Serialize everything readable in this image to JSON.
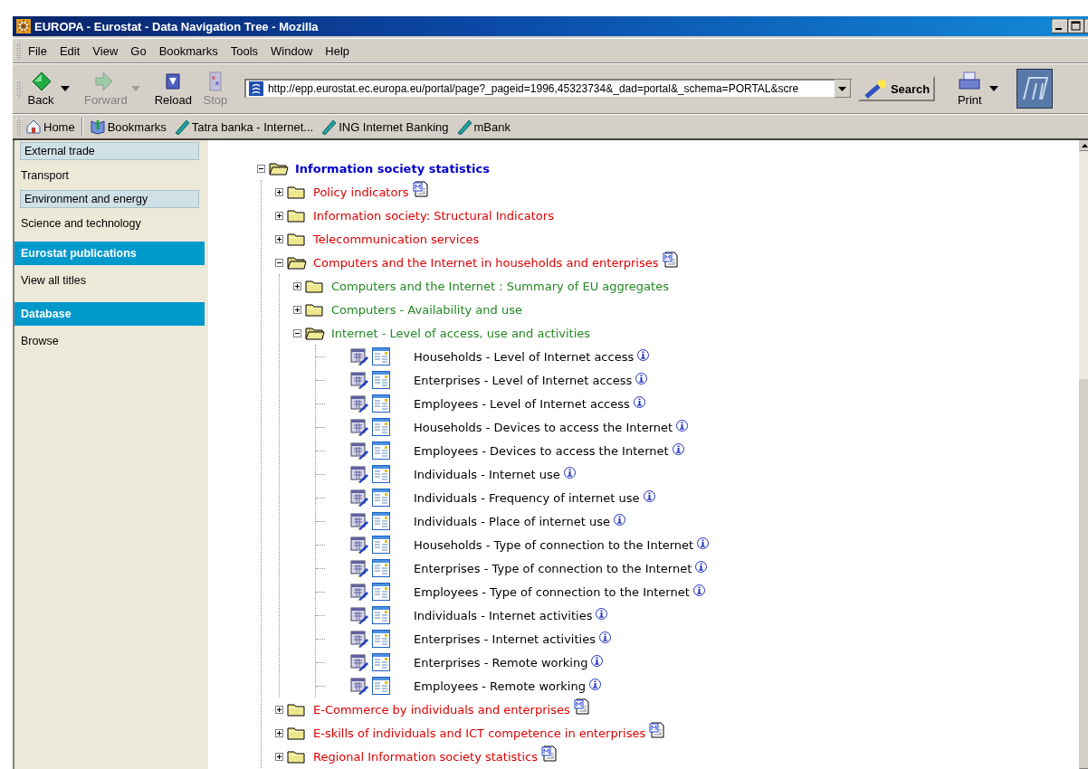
{
  "window": {
    "title": "EUROPA - Eurostat - Data Navigation Tree - Mozilla"
  },
  "menu": [
    "File",
    "Edit",
    "View",
    "Go",
    "Bookmarks",
    "Tools",
    "Window",
    "Help"
  ],
  "toolbar": {
    "buttons": [
      {
        "label": "Back",
        "kind": "back",
        "disabled": false,
        "dropdown": true
      },
      {
        "label": "Forward",
        "kind": "forward",
        "disabled": true,
        "dropdown": true
      },
      {
        "label": "Reload",
        "kind": "reload",
        "disabled": false,
        "dropdown": false
      },
      {
        "label": "Stop",
        "kind": "stop",
        "disabled": true,
        "dropdown": false
      }
    ],
    "address": "http://epp.eurostat.ec.europa.eu/portal/page?_pageid=1996,45323734&_dad=portal&_schema=PORTAL&scre",
    "search_button": "Search",
    "print_button": "Print"
  },
  "bookmarks": [
    {
      "label": "Home",
      "kind": "home"
    },
    {
      "label": "Bookmarks",
      "kind": "bookmarks"
    },
    {
      "label": "Tatra banka - Internet...",
      "kind": "link"
    },
    {
      "label": "ING Internet Banking",
      "kind": "link"
    },
    {
      "label": "mBank",
      "kind": "link"
    }
  ],
  "sidebar": {
    "items": [
      {
        "label": "External trade",
        "kind": "boxed"
      },
      {
        "label": "Transport",
        "kind": "link"
      },
      {
        "label": "Environment and energy",
        "kind": "boxed"
      },
      {
        "label": "Science and technology",
        "kind": "link"
      },
      {
        "label": "Eurostat publications",
        "kind": "header"
      },
      {
        "label": "View all titles",
        "kind": "link"
      },
      {
        "label": "Database",
        "kind": "header"
      },
      {
        "label": "Browse",
        "kind": "link"
      }
    ]
  },
  "tree": {
    "label": "Information society statistics",
    "kind": "folder",
    "expanded": true,
    "metadata": false,
    "children": [
      {
        "label": "Policy indicators",
        "kind": "folder",
        "expanded": false,
        "metadata": true
      },
      {
        "label": "Information society: Structural Indicators",
        "kind": "folder",
        "expanded": false,
        "metadata": false
      },
      {
        "label": "Telecommunication services",
        "kind": "folder",
        "expanded": false,
        "metadata": false
      },
      {
        "label": "Computers and the Internet in households and enterprises",
        "kind": "folder",
        "expanded": true,
        "metadata": true,
        "children": [
          {
            "label": "Computers and the Internet : Summary of EU aggregates",
            "kind": "folder",
            "expanded": false,
            "metadata": false
          },
          {
            "label": "Computers - Availability and use",
            "kind": "folder",
            "expanded": false,
            "metadata": false
          },
          {
            "label": "Internet - Level of access, use and activities",
            "kind": "folder",
            "expanded": true,
            "metadata": false,
            "children": [
              {
                "label": "Households - Level of Internet access",
                "kind": "dataset"
              },
              {
                "label": "Enterprises - Level of Internet access",
                "kind": "dataset"
              },
              {
                "label": "Employees - Level of Internet access",
                "kind": "dataset"
              },
              {
                "label": "Households - Devices to access the Internet",
                "kind": "dataset"
              },
              {
                "label": "Employees - Devices to access the Internet",
                "kind": "dataset"
              },
              {
                "label": "Individuals - Internet use",
                "kind": "dataset"
              },
              {
                "label": "Individuals - Frequency of internet use",
                "kind": "dataset"
              },
              {
                "label": "Individuals - Place of internet use",
                "kind": "dataset"
              },
              {
                "label": "Households - Type of connection to the Internet",
                "kind": "dataset"
              },
              {
                "label": "Enterprises - Type of connection to the Internet",
                "kind": "dataset"
              },
              {
                "label": "Employees - Type of connection to the Internet",
                "kind": "dataset"
              },
              {
                "label": "Individuals - Internet activities",
                "kind": "dataset"
              },
              {
                "label": "Enterprises - Internet activities",
                "kind": "dataset"
              },
              {
                "label": "Enterprises - Remote working",
                "kind": "dataset"
              },
              {
                "label": "Employees - Remote working",
                "kind": "dataset"
              }
            ]
          }
        ]
      },
      {
        "label": "E-Commerce by individuals and enterprises",
        "kind": "folder",
        "expanded": false,
        "metadata": true
      },
      {
        "label": "E-skills of individuals and ICT competence in enterprises",
        "kind": "folder",
        "expanded": false,
        "metadata": true
      },
      {
        "label": "Regional Information society statistics",
        "kind": "folder",
        "expanded": false,
        "metadata": true
      }
    ]
  }
}
